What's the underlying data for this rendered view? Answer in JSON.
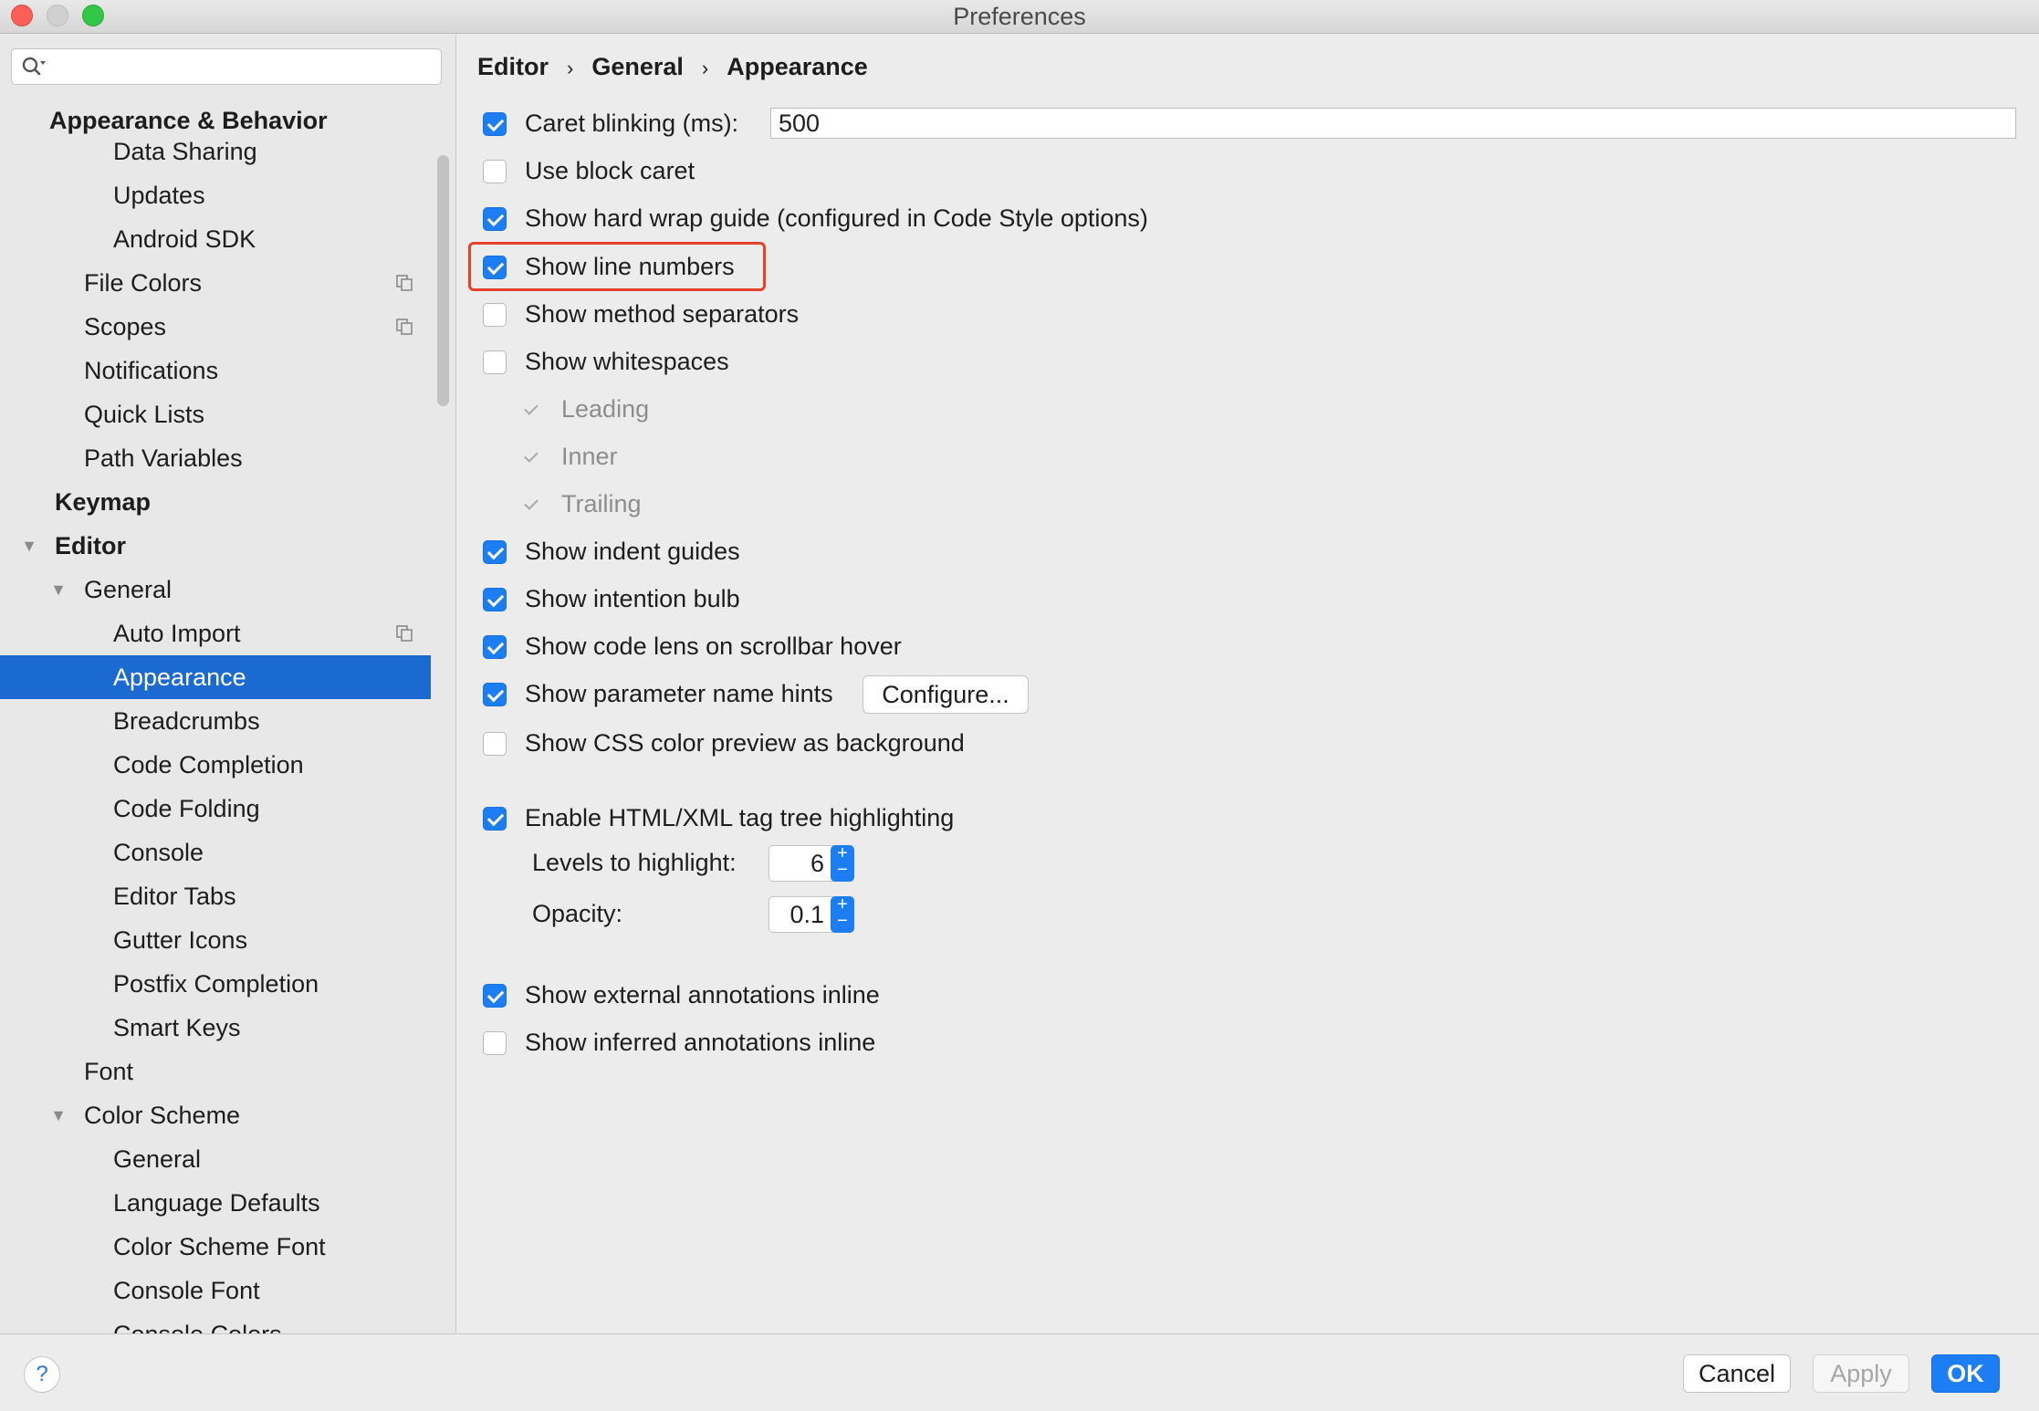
{
  "window": {
    "title": "Preferences"
  },
  "search": {
    "placeholder": ""
  },
  "sidebar": {
    "items": [
      {
        "label": "Appearance & Behavior"
      },
      {
        "label": "Data Sharing"
      },
      {
        "label": "Updates"
      },
      {
        "label": "Android SDK"
      },
      {
        "label": "File Colors"
      },
      {
        "label": "Scopes"
      },
      {
        "label": "Notifications"
      },
      {
        "label": "Quick Lists"
      },
      {
        "label": "Path Variables"
      },
      {
        "label": "Keymap"
      },
      {
        "label": "Editor"
      },
      {
        "label": "General"
      },
      {
        "label": "Auto Import"
      },
      {
        "label": "Appearance"
      },
      {
        "label": "Breadcrumbs"
      },
      {
        "label": "Code Completion"
      },
      {
        "label": "Code Folding"
      },
      {
        "label": "Console"
      },
      {
        "label": "Editor Tabs"
      },
      {
        "label": "Gutter Icons"
      },
      {
        "label": "Postfix Completion"
      },
      {
        "label": "Smart Keys"
      },
      {
        "label": "Font"
      },
      {
        "label": "Color Scheme"
      },
      {
        "label": "General"
      },
      {
        "label": "Language Defaults"
      },
      {
        "label": "Color Scheme Font"
      },
      {
        "label": "Console Font"
      },
      {
        "label": "Console Colors"
      }
    ]
  },
  "breadcrumb": {
    "items": [
      "Editor",
      "General",
      "Appearance"
    ],
    "separator": "›"
  },
  "options": {
    "caret_blinking": {
      "label": "Caret blinking (ms):",
      "checked": true,
      "value": "500"
    },
    "block_caret": {
      "label": "Use block caret",
      "checked": false
    },
    "hard_wrap": {
      "label": "Show hard wrap guide (configured in Code Style options)",
      "checked": true
    },
    "line_numbers": {
      "label": "Show line numbers",
      "checked": true
    },
    "method_separators": {
      "label": "Show method separators",
      "checked": false
    },
    "whitespaces": {
      "label": "Show whitespaces",
      "checked": false
    },
    "leading": {
      "label": "Leading",
      "checked": true
    },
    "inner": {
      "label": "Inner",
      "checked": true
    },
    "trailing": {
      "label": "Trailing",
      "checked": true
    },
    "indent_guides": {
      "label": "Show indent guides",
      "checked": true
    },
    "intention_bulb": {
      "label": "Show intention bulb",
      "checked": true
    },
    "code_lens": {
      "label": "Show code lens on scrollbar hover",
      "checked": true
    },
    "param_hints": {
      "label": "Show parameter name hints",
      "checked": true,
      "button": "Configure..."
    },
    "css_preview": {
      "label": "Show CSS color preview as background",
      "checked": false
    },
    "tag_tree": {
      "label": "Enable HTML/XML tag tree highlighting",
      "checked": true
    },
    "levels": {
      "label": "Levels to highlight:",
      "value": "6"
    },
    "opacity": {
      "label": "Opacity:",
      "value": "0.1"
    },
    "external_annotations": {
      "label": "Show external annotations inline",
      "checked": true
    },
    "inferred_annotations": {
      "label": "Show inferred annotations inline",
      "checked": false
    }
  },
  "footer": {
    "help": "?",
    "cancel": "Cancel",
    "apply": "Apply",
    "ok": "OK"
  },
  "colors": {
    "accent": "#1d7ef3",
    "selection": "#1b6ad1",
    "highlight_box": "#e8412a"
  }
}
